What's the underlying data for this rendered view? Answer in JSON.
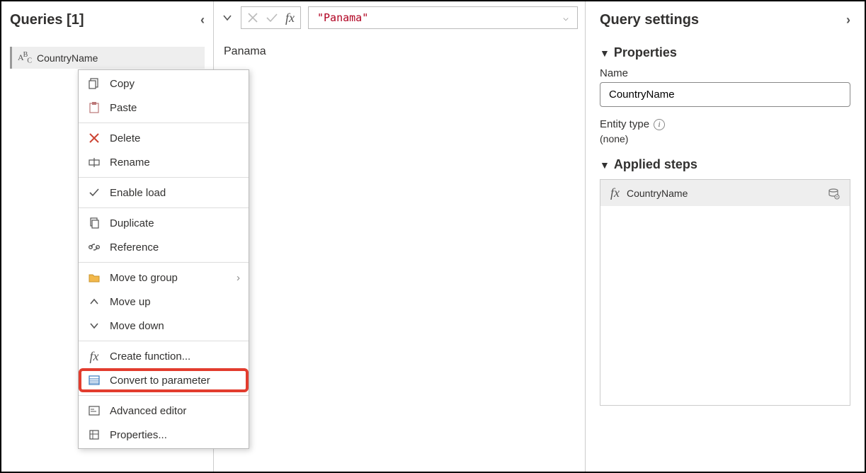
{
  "queries": {
    "title": "Queries [1]",
    "items": [
      {
        "name": "CountryName"
      }
    ]
  },
  "contextMenu": {
    "copy": "Copy",
    "paste": "Paste",
    "delete": "Delete",
    "rename": "Rename",
    "enableLoad": "Enable load",
    "duplicate": "Duplicate",
    "reference": "Reference",
    "moveToGroup": "Move to group",
    "moveUp": "Move up",
    "moveDown": "Move down",
    "createFunction": "Create function...",
    "convertToParameter": "Convert to parameter",
    "advancedEditor": "Advanced editor",
    "properties": "Properties..."
  },
  "formulaBar": {
    "value": "\"Panama\""
  },
  "output": {
    "value": "Panama"
  },
  "settings": {
    "title": "Query settings",
    "sectionProperties": "Properties",
    "nameLabel": "Name",
    "nameValue": "CountryName",
    "entityTypeLabel": "Entity type",
    "entityTypeValue": "(none)",
    "sectionApplied": "Applied steps",
    "steps": [
      {
        "name": "CountryName"
      }
    ]
  }
}
